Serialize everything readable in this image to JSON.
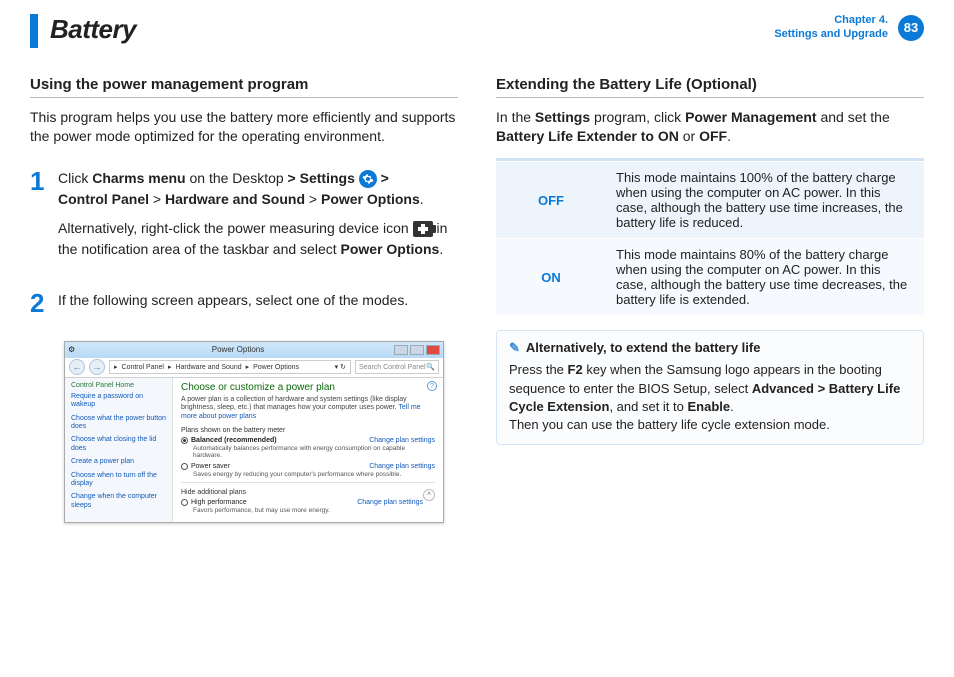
{
  "header": {
    "title": "Battery",
    "chapter_line1": "Chapter 4.",
    "chapter_line2": "Settings and Upgrade",
    "page_number": "83"
  },
  "left": {
    "section_heading": "Using the power management program",
    "intro": "This program helps you use the battery more efficiently and supports the power mode optimized for the operating environment.",
    "step1": {
      "num": "1",
      "line1a": "Click ",
      "line1b": "Charms menu",
      "line1c": " on the Desktop ",
      "gt1": ">",
      "settings": " Settings ",
      "gt2": " > ",
      "line2a": "Control Panel",
      "gt3": " > ",
      "line2b": "Hardware and Sound",
      "gt4": " > ",
      "line2c": "Power Options",
      "dot": ".",
      "alt1": "Alternatively, right-click the power measuring device icon ",
      "alt2": " in the notification area of the taskbar and select ",
      "alt3": "Power Options",
      "alt4": "."
    },
    "step2": {
      "num": "2",
      "text": "If the following screen appears, select one of the modes."
    },
    "winshot": {
      "title": "Power Options",
      "crumb": [
        "Control Panel",
        "Hardware and Sound",
        "Power Options"
      ],
      "search_placeholder": "Search Control Panel",
      "side_home": "Control Panel Home",
      "side_links": [
        "Require a password on wakeup",
        "Choose what the power button does",
        "Choose what closing the lid does",
        "Create a power plan",
        "Choose when to turn off the display",
        "Change when the computer sleeps"
      ],
      "main_heading": "Choose or customize a power plan",
      "main_desc": "A power plan is a collection of hardware and system settings (like display brightness, sleep, etc.) that manages how your computer uses power. ",
      "main_link": "Tell me more about power plans",
      "plans_label": "Plans shown on the battery meter",
      "plan1": {
        "name": "Balanced (recommended)",
        "desc": "Automatically balances performance with energy consumption on capable hardware.",
        "change": "Change plan settings"
      },
      "plan2": {
        "name": "Power saver",
        "desc": "Saves energy by reducing your computer's performance where possible.",
        "change": "Change plan settings"
      },
      "hide_label": "Hide additional plans",
      "plan3": {
        "name": "High performance",
        "desc": "Favors performance, but may use more energy.",
        "change": "Change plan settings"
      }
    }
  },
  "right": {
    "section_heading": "Extending the Battery Life (Optional)",
    "intro_a": "In the ",
    "intro_b": "Settings",
    "intro_c": " program, click ",
    "intro_d": "Power Management",
    "intro_e": " and set the ",
    "intro_f": "Battery Life Extender to ON",
    "intro_g": " or ",
    "intro_h": "OFF",
    "intro_i": ".",
    "table": {
      "off_label": "OFF",
      "off_desc": "This mode maintains 100% of the battery charge when using the computer on AC power. In this case, although the battery use time increases, the battery life is reduced.",
      "on_label": "ON",
      "on_desc": "This mode maintains 80% of the battery charge when using the computer on AC power. In this case, although the battery use time decreases, the battery life is extended."
    },
    "note": {
      "title": "Alternatively, to extend the battery life",
      "l1a": "Press the ",
      "l1b": "F2",
      "l1c": " key when the Samsung logo appears in the booting sequence to enter the BIOS Setup, select ",
      "l1d": "Advanced > Battery Life Cycle Extension",
      "l1e": ", and set it to ",
      "l1f": "Enable",
      "l1g": ".",
      "l2": "Then you can use the battery life cycle extension mode."
    }
  }
}
